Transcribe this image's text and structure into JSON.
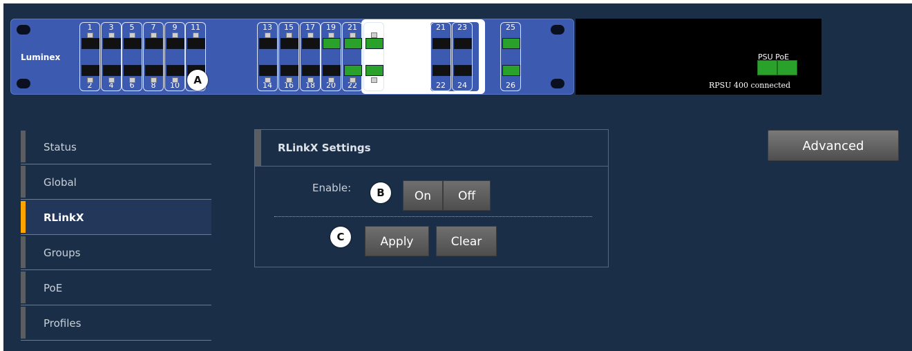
{
  "panel": {
    "brand": "Luminex",
    "ports_top": [
      {
        "num": "1",
        "color": "black"
      },
      {
        "num": "3",
        "color": "black"
      },
      {
        "num": "5",
        "color": "black"
      },
      {
        "num": "7",
        "color": "black"
      },
      {
        "num": "9",
        "color": "black"
      },
      {
        "num": "11",
        "color": "black"
      },
      {
        "num": "13",
        "color": "black"
      },
      {
        "num": "15",
        "color": "black"
      },
      {
        "num": "17",
        "color": "black"
      },
      {
        "num": "19",
        "color": "green"
      },
      {
        "num": "21",
        "color": "green"
      },
      {
        "num": "23",
        "color": "green"
      },
      {
        "num": "21",
        "color": "black"
      },
      {
        "num": "23",
        "color": "black"
      },
      {
        "num": "25",
        "color": "green"
      }
    ],
    "ports_bottom": [
      {
        "num": "2",
        "color": "black"
      },
      {
        "num": "4",
        "color": "black"
      },
      {
        "num": "6",
        "color": "black"
      },
      {
        "num": "8",
        "color": "black"
      },
      {
        "num": "10",
        "color": "black"
      },
      {
        "num": "12",
        "color": "black"
      },
      {
        "num": "14",
        "color": "black"
      },
      {
        "num": "16",
        "color": "black"
      },
      {
        "num": "18",
        "color": "black"
      },
      {
        "num": "20",
        "color": "black"
      },
      {
        "num": "22",
        "color": "green"
      },
      {
        "num": "24",
        "color": "green"
      },
      {
        "num": "22",
        "color": "black"
      },
      {
        "num": "24",
        "color": "black"
      },
      {
        "num": "26",
        "color": "green"
      }
    ]
  },
  "rpsu": {
    "label": "PSU PoE",
    "status": "RPSU 400 connected"
  },
  "callouts": {
    "a": "A",
    "b": "B",
    "c": "C"
  },
  "sidebar": {
    "items": [
      {
        "label": "Status",
        "active": false
      },
      {
        "label": "Global",
        "active": false
      },
      {
        "label": "RLinkX",
        "active": true
      },
      {
        "label": "Groups",
        "active": false
      },
      {
        "label": "PoE",
        "active": false
      },
      {
        "label": "Profiles",
        "active": false
      }
    ]
  },
  "settings": {
    "title": "RLinkX Settings",
    "enable_label": "Enable:",
    "on_label": "On",
    "off_label": "Off",
    "apply_label": "Apply",
    "clear_label": "Clear"
  },
  "advanced_label": "Advanced",
  "colors": {
    "background": "#1b2e48",
    "panel": "#3c5bb0",
    "link_active": "#2aa12a",
    "active_accent": "#ffa500"
  }
}
